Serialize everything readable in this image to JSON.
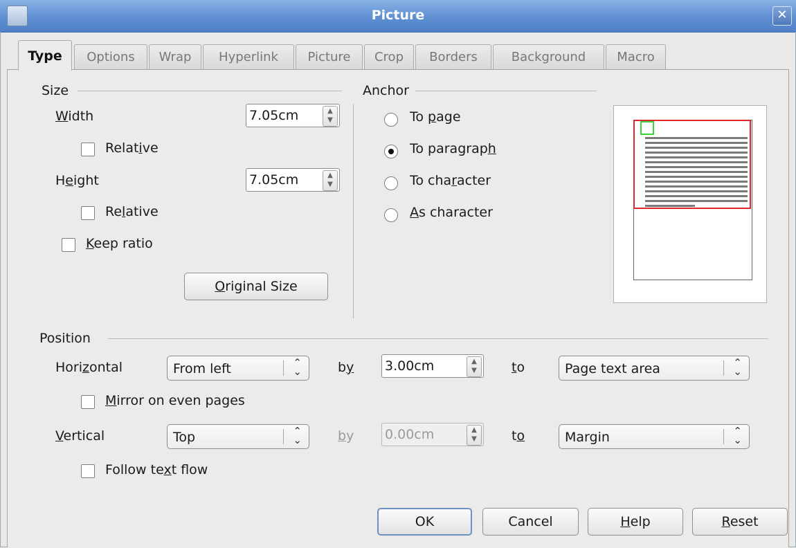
{
  "window": {
    "title": "Picture"
  },
  "tabs": [
    "Type",
    "Options",
    "Wrap",
    "Hyperlink",
    "Picture",
    "Crop",
    "Borders",
    "Background",
    "Macro"
  ],
  "active_tab": "Type",
  "size": {
    "section_label": "Size",
    "width_label": "Width",
    "width_value": "7.05cm",
    "width_relative_label": "Relative",
    "width_relative_checked": false,
    "height_label": "Height",
    "height_value": "7.05cm",
    "height_relative_label": "Relative",
    "height_relative_checked": false,
    "keep_ratio_label": "Keep ratio",
    "keep_ratio_checked": false,
    "original_size_label": "Original Size"
  },
  "anchor": {
    "section_label": "Anchor",
    "options": [
      "To page",
      "To paragraph",
      "To character",
      "As character"
    ],
    "selected": "To paragraph"
  },
  "position": {
    "section_label": "Position",
    "horizontal_label": "Horizontal",
    "horizontal_value": "From left",
    "horizontal_by_label": "by",
    "horizontal_by_value": "3.00cm",
    "horizontal_to_label": "to",
    "horizontal_to_value": "Page text area",
    "mirror_label": "Mirror on even pages",
    "mirror_checked": false,
    "vertical_label": "Vertical",
    "vertical_value": "Top",
    "vertical_by_label": "by",
    "vertical_by_value": "0.00cm",
    "vertical_to_label": "to",
    "vertical_to_value": "Margin",
    "follow_label": "Follow text flow",
    "follow_checked": false
  },
  "buttons": {
    "ok": "OK",
    "cancel": "Cancel",
    "help": "Help",
    "reset": "Reset"
  },
  "colors": {
    "titlebar": "#5f8fd2",
    "anchor_paragraph_frame": "#e0262a",
    "picture_frame": "#3ad33a"
  },
  "icons": {
    "window": "app-icon",
    "close": "close-icon"
  }
}
